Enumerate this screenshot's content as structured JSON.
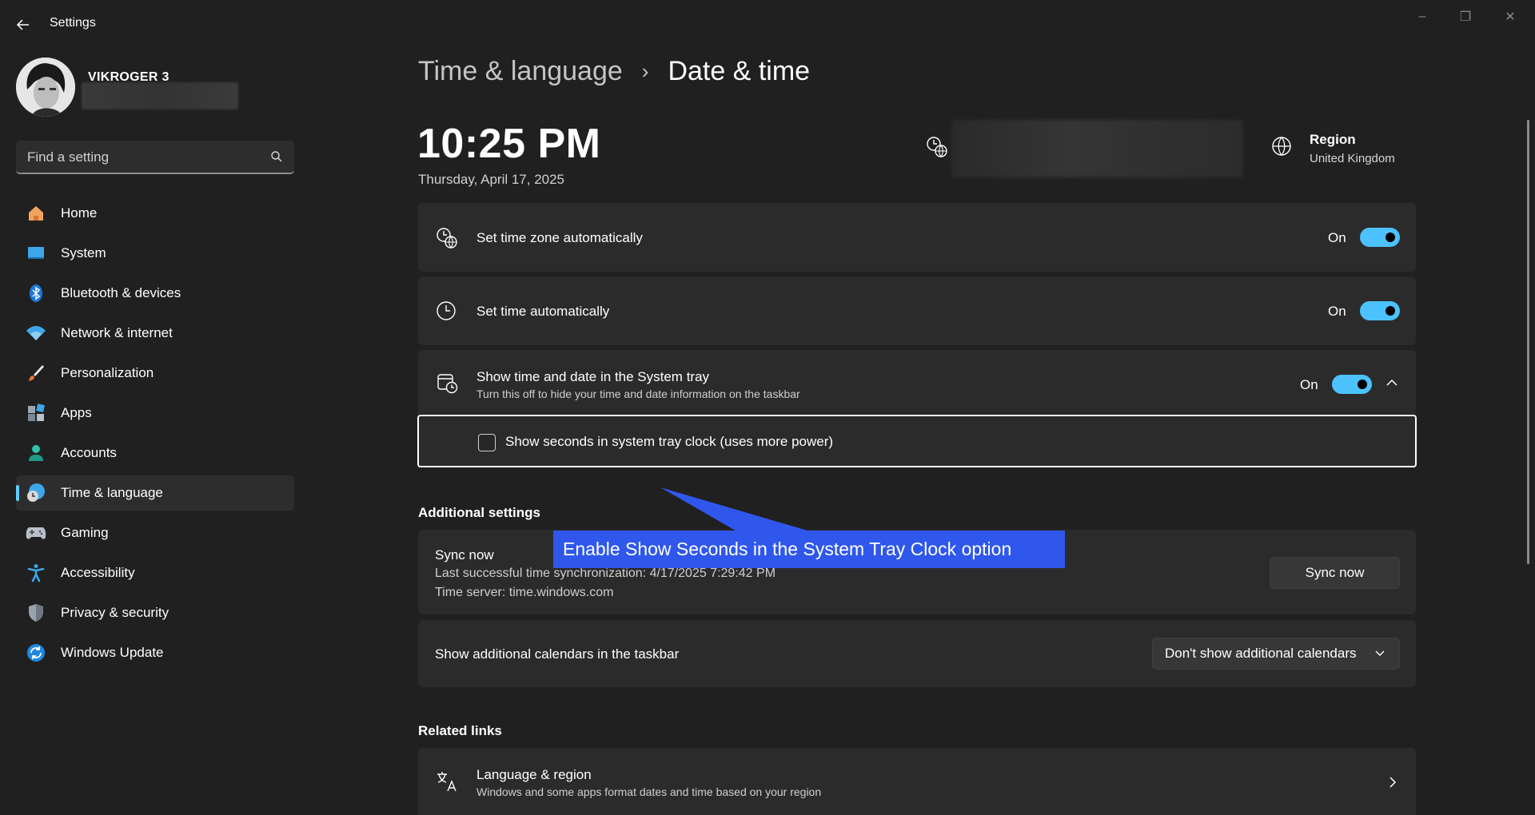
{
  "window": {
    "title": "Settings",
    "controls": {
      "minimize": "–",
      "restore": "❐",
      "close": "✕"
    }
  },
  "profile": {
    "name": "VIKROGER 3"
  },
  "search": {
    "placeholder": "Find a setting"
  },
  "nav": {
    "items": [
      {
        "label": "Home",
        "icon": "home-icon"
      },
      {
        "label": "System",
        "icon": "system-icon"
      },
      {
        "label": "Bluetooth & devices",
        "icon": "bluetooth-icon"
      },
      {
        "label": "Network & internet",
        "icon": "wifi-icon"
      },
      {
        "label": "Personalization",
        "icon": "brush-icon"
      },
      {
        "label": "Apps",
        "icon": "apps-icon"
      },
      {
        "label": "Accounts",
        "icon": "accounts-icon"
      },
      {
        "label": "Time & language",
        "icon": "time-language-icon",
        "active": true
      },
      {
        "label": "Gaming",
        "icon": "gamepad-icon"
      },
      {
        "label": "Accessibility",
        "icon": "accessibility-icon"
      },
      {
        "label": "Privacy & security",
        "icon": "shield-icon"
      },
      {
        "label": "Windows Update",
        "icon": "update-icon"
      }
    ]
  },
  "header": {
    "breadcrumb_parent": "Time & language",
    "breadcrumb_separator": "›",
    "breadcrumb_current": "Date & time"
  },
  "clock": {
    "time": "10:25 PM",
    "date": "Thursday, April 17, 2025"
  },
  "region": {
    "label": "Region",
    "value": "United Kingdom"
  },
  "settings": {
    "timezone_auto": {
      "title": "Set time zone automatically",
      "state": "On"
    },
    "time_auto": {
      "title": "Set time automatically",
      "state": "On"
    },
    "tray": {
      "title": "Show time and date in the System tray",
      "subtitle": "Turn this off to hide your time and date information on the taskbar",
      "state": "On",
      "seconds_checkbox_label": "Show seconds in system tray clock (uses more power)"
    }
  },
  "additional": {
    "section_title": "Additional settings",
    "sync": {
      "title": "Sync now",
      "last_sync": "Last successful time synchronization: 4/17/2025 7:29:42 PM",
      "server": "Time server: time.windows.com",
      "button": "Sync now"
    },
    "calendars": {
      "title": "Show additional calendars in the taskbar",
      "selected": "Don't show additional calendars"
    }
  },
  "related": {
    "section_title": "Related links",
    "language_region": {
      "title": "Language & region",
      "subtitle": "Windows and some apps format dates and time based on your region"
    }
  },
  "annotation": {
    "text": "Enable Show Seconds in the System Tray Clock option"
  },
  "colors": {
    "accent": "#4cc2ff",
    "background": "#202020",
    "card": "#2b2b2b",
    "callout": "#2f57ec"
  }
}
